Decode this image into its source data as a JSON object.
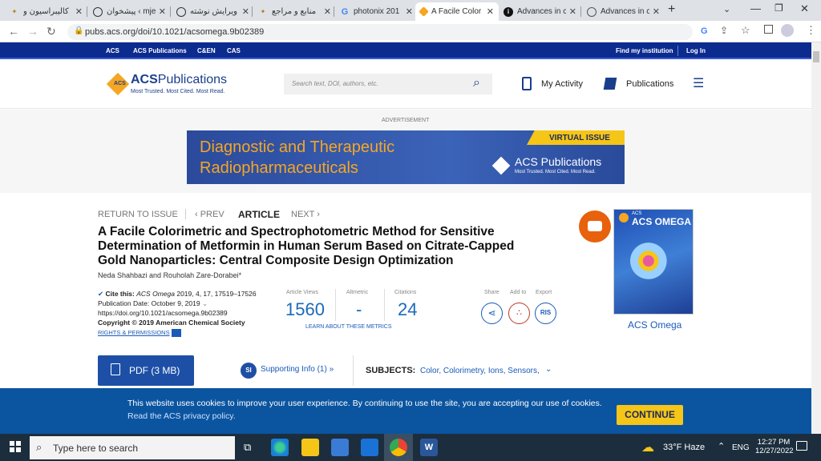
{
  "browser": {
    "tabs": [
      {
        "label": "كاليبراسيون و",
        "icon": "bookmark-favicon-icon",
        "active": false
      },
      {
        "label": "پیشخوان ‹ mje",
        "icon": "wordpress-icon",
        "active": false
      },
      {
        "label": "ویرایش نوشته",
        "icon": "wordpress-icon",
        "active": false
      },
      {
        "label": "منابع و مراجع",
        "icon": "bookmark-favicon-icon",
        "active": false
      },
      {
        "label": "photonix 201",
        "icon": "google-icon",
        "active": false
      },
      {
        "label": "A Facile Color",
        "icon": "acs-favicon-icon",
        "active": true
      },
      {
        "label": "Advances in c",
        "icon": "semantic-favicon-icon",
        "active": false
      },
      {
        "label": "Advances in c",
        "icon": "globe-icon",
        "active": false
      }
    ],
    "new_tab": "+",
    "url": "pubs.acs.org/doi/10.1021/acsomega.9b02389"
  },
  "site": {
    "topbar_left": [
      "ACS",
      "ACS Publications",
      "C&EN",
      "CAS"
    ],
    "topbar_right": [
      "Find my institution",
      "Log In"
    ],
    "logo_main": "ACS",
    "logo_pub": "Publications",
    "tagline": "Most Trusted. Most Cited. Most Read.",
    "search_placeholder": "Search text, DOI, authors, etc.",
    "my_activity": "My Activity",
    "publications": "Publications",
    "advertisement_label": "ADVERTISEMENT",
    "ad": {
      "line1": "Diagnostic and Therapeutic",
      "line2": "Radiopharmaceuticals",
      "badge": "VIRTUAL ISSUE",
      "brand": "ACS Publications",
      "brand_tag": "Most Trusted. Most Cited. Most Read."
    }
  },
  "article_nav": {
    "return": "RETURN TO ISSUE",
    "prev": "‹ PREV",
    "current": "ARTICLE",
    "next": "NEXT ›"
  },
  "article": {
    "title_line1": "A Facile Colorimetric and Spectrophotometric Method for Sensitive",
    "title_line2": "Determination of Metformin in Human Serum Based on Citrate-Capped",
    "title_line3": "Gold Nanoparticles: Central Composite Design Optimization",
    "authors": "Neda Shahbazi and Rouholah Zare-Dorabei*",
    "cite_label": "Cite this:",
    "cite_journal": "ACS Omega",
    "cite_rest": "2019, 4, 17, 17519–17526",
    "pub_date": "Publication Date: October 9, 2019",
    "doi": "https://doi.org/10.1021/acsomega.9b02389",
    "copyright": "Copyright © 2019 American Chemical Society",
    "rights": "RIGHTS & PERMISSIONS",
    "metrics": {
      "views_label": "Article Views",
      "views": "1560",
      "altmetric_label": "Altmetric",
      "altmetric": "-",
      "citations_label": "Citations",
      "citations": "24",
      "learn": "LEARN ABOUT THESE METRICS"
    },
    "actions": {
      "share": "Share",
      "add": "Add to",
      "export": "Export",
      "ris": "RIS"
    },
    "pdf": "PDF (3 MB)",
    "si_badge": "SI",
    "supporting": "Supporting Info (1) »",
    "subjects_label": "SUBJECTS:",
    "subjects": "Color, Colorimetry, Ions, Sensors,",
    "journal_name": "ACS Omega",
    "cover_title": "ACS OMEGA",
    "cover_pre": "ACS"
  },
  "cookie": {
    "text": "This website uses cookies to improve your user experience. By continuing to use the site, you are accepting our use of cookies.",
    "link": "Read the ACS privacy policy.",
    "button": "CONTINUE"
  },
  "taskbar": {
    "search": "Type here to search",
    "weather": "33°F  Haze",
    "lang": "ENG",
    "time": "12:27 PM",
    "date": "12/27/2022"
  }
}
